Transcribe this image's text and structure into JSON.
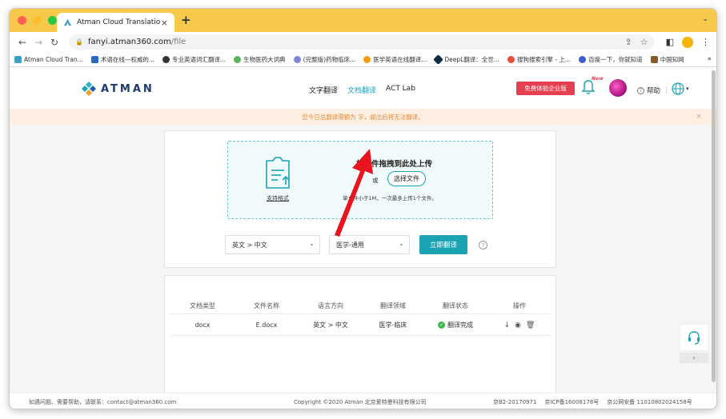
{
  "browser": {
    "tab_title": "Atman Cloud Translation",
    "tab_close": "×",
    "new_tab": "+",
    "tab_menu": "⌄",
    "url_host": "fanyi.atman360.com",
    "url_path": "/file",
    "bookmarks": [
      {
        "label": "Atman Cloud Tran...",
        "color": "#3aa0c8"
      },
      {
        "label": "术语在线—权威的...",
        "color": "#2a6bb5"
      },
      {
        "label": "专业英语词汇翻译...",
        "color": "#333333"
      },
      {
        "label": "生物医药大词典",
        "color": "#5bb35b"
      },
      {
        "label": "(完整版)药物临床...",
        "color": "#7a86d8"
      },
      {
        "label": "医学英语在线翻译...",
        "color": "#f39c12"
      },
      {
        "label": "DeepL翻译：全世...",
        "color": "#0f2b46"
      },
      {
        "label": "搜狗搜索引擎 - 上...",
        "color": "#e74c3c"
      },
      {
        "label": "百度一下，你就知道",
        "color": "#3a5fcd"
      },
      {
        "label": "中国知网",
        "color": "#8b5a2b"
      }
    ],
    "bookmarks_more": "»"
  },
  "header": {
    "logo_text": "ATMAN",
    "nav": [
      {
        "label": "文字翻译",
        "active": false
      },
      {
        "label": "文档翻译",
        "active": true
      },
      {
        "label": "ACT Lab",
        "active": false
      }
    ],
    "trial_button": "免费体验企业版",
    "new_badge": "New",
    "help_label": "帮助",
    "help_mark": "?",
    "divider": "|",
    "globe_caret": "▾"
  },
  "notice": {
    "text": "您今日总翻译需额为 字，超出后将无法翻译。",
    "close": "×"
  },
  "upload": {
    "supported_formats": "支持格式",
    "title": "将文件拖拽到此处上传",
    "or": "或",
    "choose_file": "选择文件",
    "limit": "单文件小于1M，一次最多上传1个文件。"
  },
  "controls": {
    "language": "英文 > 中文",
    "domain": "医学-通用",
    "translate_button": "立即翻译",
    "caret": "▾",
    "qmark": "?"
  },
  "table": {
    "headers": [
      "文档类型",
      "文件名称",
      "语言方向",
      "翻译领域",
      "翻译状态",
      "操作"
    ],
    "rows": [
      {
        "type": "docx",
        "name": "E.docx",
        "direction": "英文 > 中文",
        "domain": "医学-临床",
        "status": "翻译完成"
      }
    ],
    "status_check": "✓",
    "op_icons": [
      "↓",
      "◉",
      "🗑"
    ]
  },
  "side": {
    "arrow": "›"
  },
  "footer": {
    "contact": "如遇问题、需要帮助，请联系：contact@atman360.com",
    "copyright": "Copyright ©2020 Atman   北京爱特曼科技有限公司",
    "icp1": "京B2-20170971",
    "icp2": "京ICP备16008178号",
    "icp3": "京公网安备 11010802024158号"
  },
  "colors": {
    "accent": "#1aa3b3",
    "trial": "#e5404f",
    "notice_text": "#e28a3a",
    "annotation_arrow": "#e8141e"
  }
}
